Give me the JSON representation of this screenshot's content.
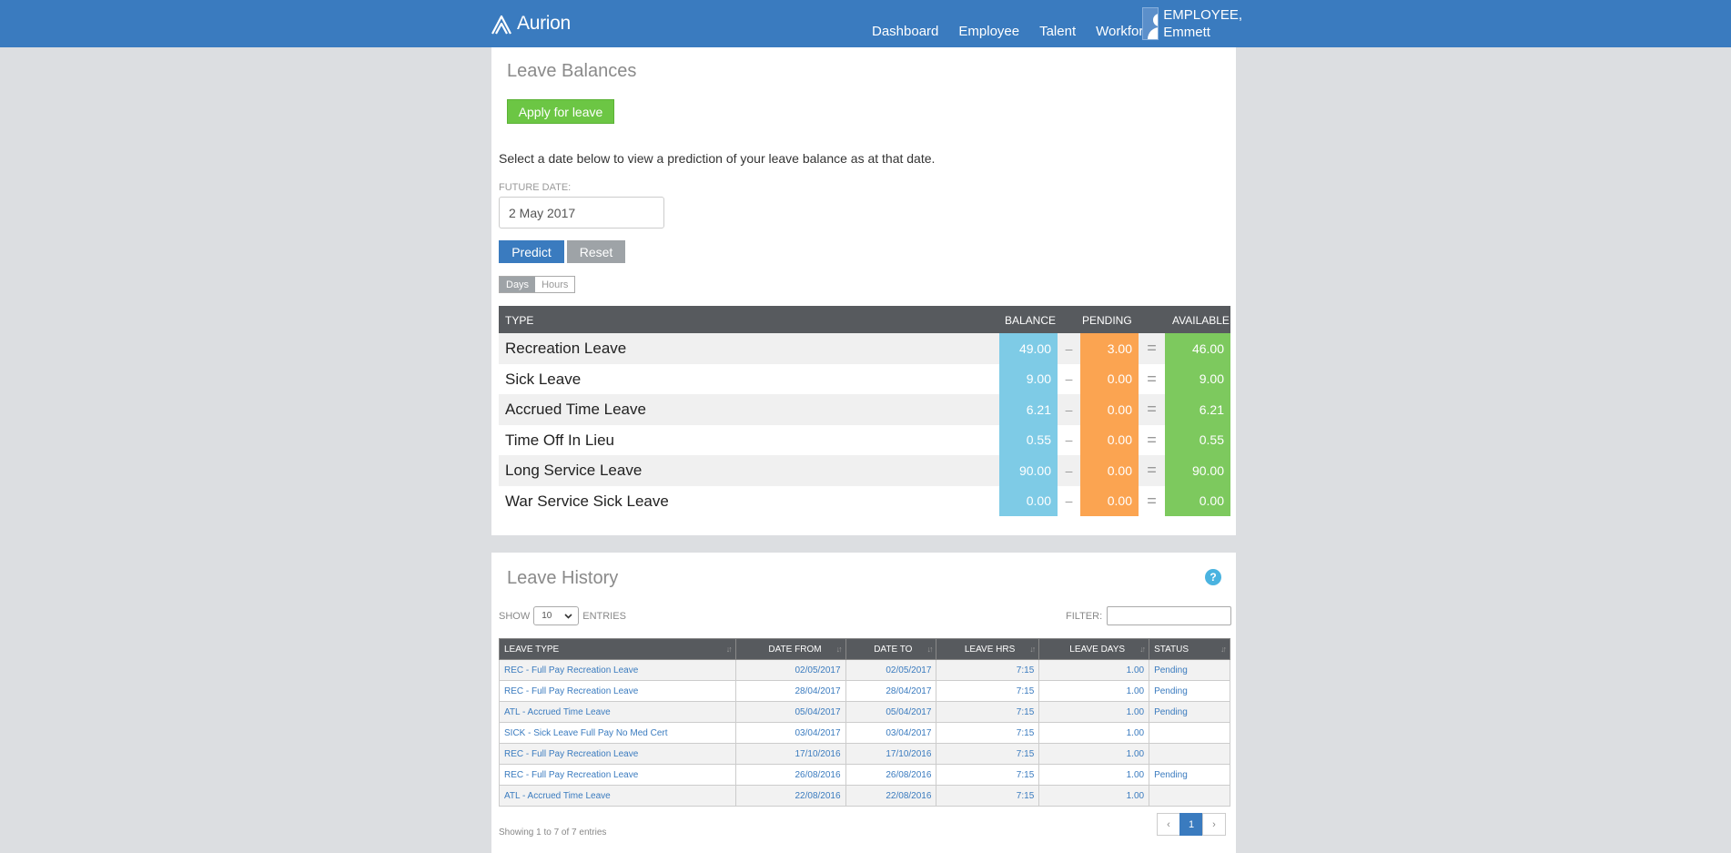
{
  "header": {
    "logo_text": "Aurion",
    "nav": [
      "Dashboard",
      "Employee",
      "Talent",
      "Workforce"
    ],
    "user_line1": "EMPLOYEE,",
    "user_line2": "Emmett"
  },
  "balances": {
    "title": "Leave Balances",
    "apply_label": "Apply for leave",
    "instructions": "Select a date below to view a prediction of your leave balance as at that date.",
    "future_label": "FUTURE DATE:",
    "future_value": "2 May 2017",
    "predict_label": "Predict",
    "reset_label": "Reset",
    "toggle_days": "Days",
    "toggle_hours": "Hours",
    "columns": {
      "type": "TYPE",
      "balance": "BALANCE",
      "pending": "PENDING",
      "available": "AVAILABLE"
    },
    "minus": "–",
    "equals": "=",
    "rows": [
      {
        "type": "Recreation Leave",
        "balance": "49.00",
        "pending": "3.00",
        "available": "46.00"
      },
      {
        "type": "Sick Leave",
        "balance": "9.00",
        "pending": "0.00",
        "available": "9.00"
      },
      {
        "type": "Accrued Time Leave",
        "balance": "6.21",
        "pending": "0.00",
        "available": "6.21"
      },
      {
        "type": "Time Off In Lieu",
        "balance": "0.55",
        "pending": "0.00",
        "available": "0.55"
      },
      {
        "type": "Long Service Leave",
        "balance": "90.00",
        "pending": "0.00",
        "available": "90.00"
      },
      {
        "type": "War Service Sick Leave",
        "balance": "0.00",
        "pending": "0.00",
        "available": "0.00"
      }
    ]
  },
  "history": {
    "title": "Leave History",
    "help": "?",
    "show_label": "SHOW",
    "show_value": "10",
    "entries_label": "ENTRIES",
    "filter_label": "FILTER:",
    "columns": [
      "LEAVE TYPE",
      "DATE FROM",
      "DATE TO",
      "LEAVE HRS",
      "LEAVE DAYS",
      "STATUS"
    ],
    "rows": [
      [
        "REC - Full Pay Recreation Leave",
        "02/05/2017",
        "02/05/2017",
        "7:15",
        "1.00",
        "Pending"
      ],
      [
        "REC - Full Pay Recreation Leave",
        "28/04/2017",
        "28/04/2017",
        "7:15",
        "1.00",
        "Pending"
      ],
      [
        "ATL - Accrued Time Leave",
        "05/04/2017",
        "05/04/2017",
        "7:15",
        "1.00",
        "Pending"
      ],
      [
        "SICK - Sick Leave Full Pay No Med Cert",
        "03/04/2017",
        "03/04/2017",
        "7:15",
        "1.00",
        ""
      ],
      [
        "REC - Full Pay Recreation Leave",
        "17/10/2016",
        "17/10/2016",
        "7:15",
        "1.00",
        ""
      ],
      [
        "REC - Full Pay Recreation Leave",
        "26/08/2016",
        "26/08/2016",
        "7:15",
        "1.00",
        "Pending"
      ],
      [
        "ATL - Accrued Time Leave",
        "22/08/2016",
        "22/08/2016",
        "7:15",
        "1.00",
        ""
      ]
    ],
    "showing_text": "Showing 1 to 7 of 7 entries",
    "pager": {
      "prev": "‹",
      "current": "1",
      "next": "›"
    }
  }
}
